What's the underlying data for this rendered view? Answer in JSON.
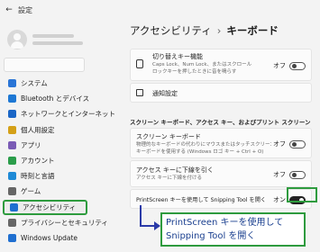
{
  "window": {
    "title": "設定"
  },
  "sidebar": {
    "items": [
      {
        "label": "システム",
        "icon": "monitor-icon",
        "color": "#2a75d6"
      },
      {
        "label": "Bluetooth とデバイス",
        "icon": "bluetooth-icon",
        "color": "#1e78d4"
      },
      {
        "label": "ネットワークとインターネット",
        "icon": "wifi-icon",
        "color": "#1a66c6"
      },
      {
        "label": "個人用設定",
        "icon": "paintbrush-icon",
        "color": "#d4a017"
      },
      {
        "label": "アプリ",
        "icon": "apps-icon",
        "color": "#7a5bb5"
      },
      {
        "label": "アカウント",
        "icon": "person-icon",
        "color": "#2a9d4a"
      },
      {
        "label": "時刻と言語",
        "icon": "globe-clock-icon",
        "color": "#1f8ad6"
      },
      {
        "label": "ゲーム",
        "icon": "controller-icon",
        "color": "#666666"
      },
      {
        "label": "アクセシビリティ",
        "icon": "accessibility-icon",
        "color": "#1f6fd0",
        "active": true
      },
      {
        "label": "プライバシーとセキュリティ",
        "icon": "shield-icon",
        "color": "#666666"
      },
      {
        "label": "Windows Update",
        "icon": "update-icon",
        "color": "#1f6fd0"
      }
    ]
  },
  "main": {
    "breadcrumb": {
      "parent": "アクセシビリティ",
      "separator": "›",
      "current": "キーボード"
    },
    "rows": {
      "filter_keys": {
        "title": "切り替えキー機能",
        "sub1": "Caps Lock、Num Lock、またはスクロール",
        "sub2": "ロックキーを押したときに音を鳴らす",
        "state": "オフ"
      },
      "notification": {
        "title": "通知設定"
      },
      "section_title": "スクリーン キーボード、アクセス キー、およびプリント スクリーン",
      "onscreen_keyboard": {
        "title": "スクリーン キーボード",
        "sub1": "物理的なキーボードの代わりにマウスまたはタッチスクリーンで",
        "sub2": "キーボードを使用する (Windows ロゴ キー + Ctrl + O)",
        "state": "オフ"
      },
      "underline": {
        "title": "アクセス キーに下線を引く",
        "sub1": "アクセス キーに下線を付ける",
        "state": "オフ"
      },
      "printscreen": {
        "title": "PrintScreen キーを使用して Snipping Tool を開く",
        "state": "オン"
      }
    },
    "callout": {
      "line1": "PrintScreen キーを使用して",
      "line2": "Snipping Tool を開く"
    }
  },
  "colors": {
    "highlight": "#2e9b3e",
    "arrow": "#2b3aa8",
    "callout_text": "#1a3f8f"
  }
}
